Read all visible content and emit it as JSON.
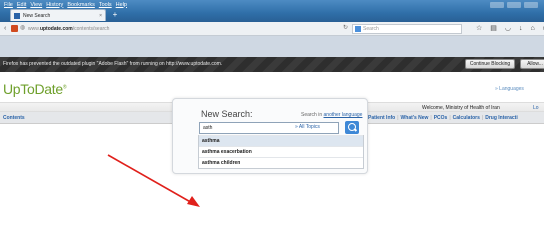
{
  "browser": {
    "menu": [
      "File",
      "Edit",
      "View",
      "History",
      "Bookmarks",
      "Tools",
      "Help"
    ],
    "tab_title": "New Search",
    "tab_close": "×",
    "new_tab": "+",
    "url_prefix": "www.",
    "url_domain": "uptodate.com",
    "url_path": "/contents/search",
    "search_placeholder": "Search",
    "plugin_message": "Firefox has prevented the outdated plugin \"Adobe Flash\" from running on http://www.uptodate.com.",
    "continue_blocking": "Continue Blocking",
    "allow": "Allow..."
  },
  "page": {
    "logo": "UpToDate",
    "logo_mark": "®",
    "languages": "» Languages",
    "welcome_prefix": "Welcome,",
    "welcome_user": "Ministry of Health of Iran",
    "login": "Lo",
    "contents": "Contents",
    "nav": [
      "Patient Info",
      "What's New",
      "PCOs",
      "Calculators",
      "Drug Interacti"
    ]
  },
  "search": {
    "title": "New Search:",
    "search_in_prefix": "Search in",
    "search_in_link": "another language",
    "input_value": "asth",
    "topic_filter": "» All Topics",
    "suggestions": [
      "asthma",
      "asthma exacerbation",
      "asthma children"
    ]
  }
}
